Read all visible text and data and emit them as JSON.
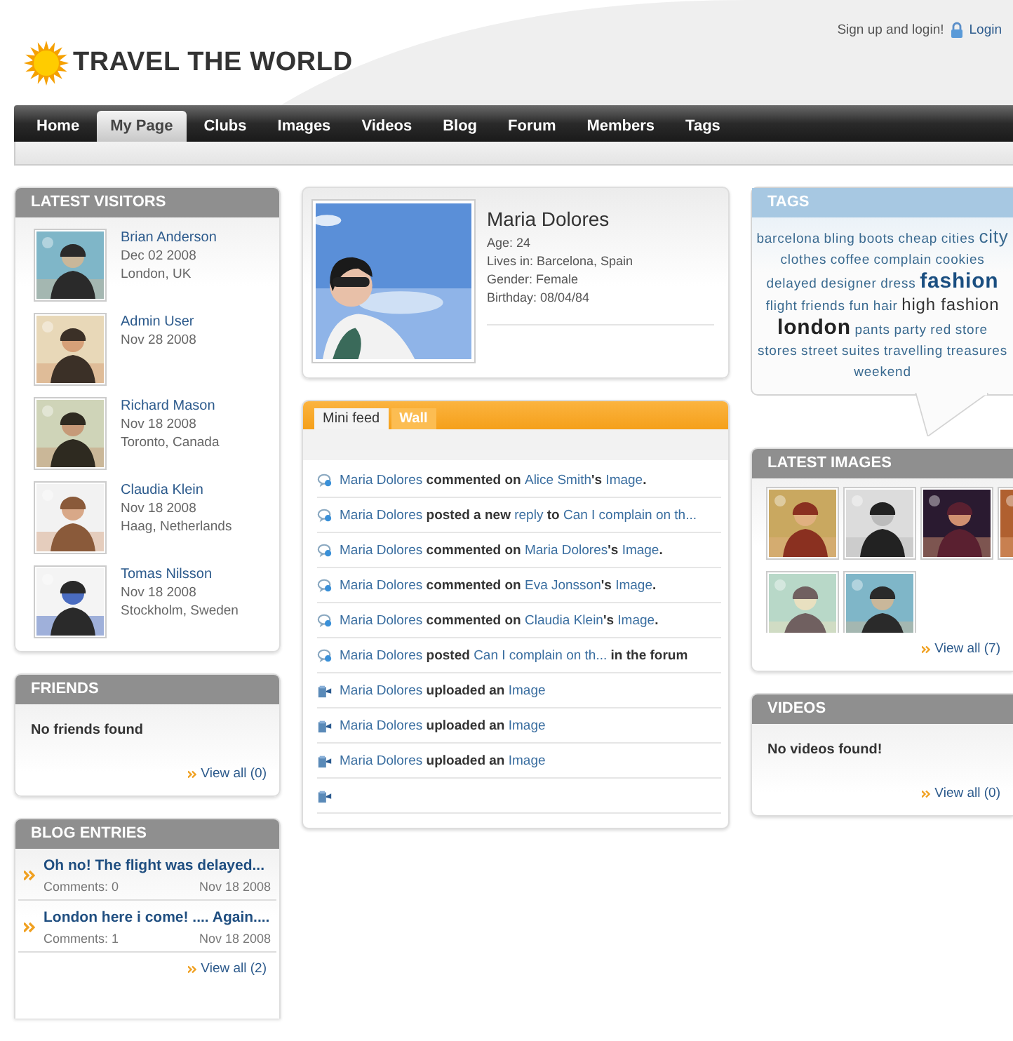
{
  "logo": {
    "title": "TRAVEL THE WORLD"
  },
  "top_links": {
    "prompt": "Sign up and login!",
    "login": "Login"
  },
  "nav": [
    {
      "label": "Home",
      "selected": false
    },
    {
      "label": "My Page",
      "selected": true
    },
    {
      "label": "Clubs",
      "selected": false
    },
    {
      "label": "Images",
      "selected": false
    },
    {
      "label": "Videos",
      "selected": false
    },
    {
      "label": "Blog",
      "selected": false
    },
    {
      "label": "Forum",
      "selected": false
    },
    {
      "label": "Members",
      "selected": false
    },
    {
      "label": "Tags",
      "selected": false
    }
  ],
  "latest_visitors": {
    "title": "LATEST VISITORS",
    "items": [
      {
        "name": "Brian Anderson",
        "date": "Dec 02 2008",
        "location": "London, UK"
      },
      {
        "name": "Admin User",
        "date": "Nov 28 2008"
      },
      {
        "name": "Richard Mason",
        "date": "Nov 18 2008",
        "location": "Toronto, Canada"
      },
      {
        "name": "Claudia Klein",
        "date": "Nov 18 2008",
        "location": "Haag, Netherlands"
      },
      {
        "name": "Tomas Nilsson",
        "date": "Nov 18 2008",
        "location": "Stockholm, Sweden"
      }
    ]
  },
  "friends": {
    "title": "FRIENDS",
    "empty": "No friends found",
    "view_all": "View all (0)"
  },
  "blog_entries": {
    "title": "BLOG ENTRIES",
    "items": [
      {
        "title": "Oh no! The flight was delayed...",
        "comments": "Comments: 0",
        "date": "Nov 18 2008"
      },
      {
        "title": "London here i come! .... Again....",
        "comments": "Comments: 1",
        "date": "Nov 18 2008"
      }
    ],
    "view_all": "View all (2)"
  },
  "profile": {
    "name": "Maria Dolores",
    "details": [
      "Age: 24",
      "Lives in: Barcelona, Spain",
      "Gender: Female",
      "Birthday: 08/04/84"
    ]
  },
  "feed": {
    "tabs": [
      {
        "label": "Mini feed",
        "selected": true
      },
      {
        "label": "Wall",
        "selected": false
      }
    ],
    "items": [
      {
        "kind": "comment",
        "parts": [
          {
            "text": "Maria Dolores",
            "kind": "link"
          },
          {
            "text": " commented on ",
            "kind": "text"
          },
          {
            "text": "Alice Smith",
            "kind": "link"
          },
          {
            "text": "'s ",
            "kind": "text"
          },
          {
            "text": "Image",
            "kind": "link"
          },
          {
            "text": ".",
            "kind": "text"
          }
        ]
      },
      {
        "kind": "comment",
        "parts": [
          {
            "text": "Maria Dolores",
            "kind": "link"
          },
          {
            "text": " posted a new ",
            "kind": "text"
          },
          {
            "text": "reply",
            "kind": "link"
          },
          {
            "text": " to ",
            "kind": "text"
          },
          {
            "text": "Can I complain on th...",
            "kind": "link"
          }
        ]
      },
      {
        "kind": "comment",
        "parts": [
          {
            "text": "Maria Dolores",
            "kind": "link"
          },
          {
            "text": " commented on ",
            "kind": "text"
          },
          {
            "text": "Maria Dolores",
            "kind": "link"
          },
          {
            "text": "'s ",
            "kind": "text"
          },
          {
            "text": "Image",
            "kind": "link"
          },
          {
            "text": ".",
            "kind": "text"
          }
        ]
      },
      {
        "kind": "comment",
        "parts": [
          {
            "text": "Maria Dolores",
            "kind": "link"
          },
          {
            "text": " commented on ",
            "kind": "text"
          },
          {
            "text": "Eva Jonsson",
            "kind": "link"
          },
          {
            "text": "'s ",
            "kind": "text"
          },
          {
            "text": "Image",
            "kind": "link"
          },
          {
            "text": ".",
            "kind": "text"
          }
        ]
      },
      {
        "kind": "comment",
        "parts": [
          {
            "text": "Maria Dolores",
            "kind": "link"
          },
          {
            "text": " commented on ",
            "kind": "text"
          },
          {
            "text": "Claudia Klein",
            "kind": "link"
          },
          {
            "text": "'s ",
            "kind": "text"
          },
          {
            "text": "Image",
            "kind": "link"
          },
          {
            "text": ".",
            "kind": "text"
          }
        ]
      },
      {
        "kind": "comment",
        "parts": [
          {
            "text": "Maria Dolores",
            "kind": "link"
          },
          {
            "text": " posted ",
            "kind": "text"
          },
          {
            "text": "Can I complain on th...",
            "kind": "link"
          },
          {
            "text": " in the forum",
            "kind": "text"
          }
        ]
      },
      {
        "kind": "upload",
        "parts": [
          {
            "text": "Maria Dolores",
            "kind": "link"
          },
          {
            "text": " uploaded an ",
            "kind": "text"
          },
          {
            "text": "Image",
            "kind": "link"
          }
        ]
      },
      {
        "kind": "upload",
        "parts": [
          {
            "text": "Maria Dolores",
            "kind": "link"
          },
          {
            "text": " uploaded an ",
            "kind": "text"
          },
          {
            "text": "Image",
            "kind": "link"
          }
        ]
      },
      {
        "kind": "upload",
        "parts": [
          {
            "text": "Maria Dolores",
            "kind": "link"
          },
          {
            "text": " uploaded an ",
            "kind": "text"
          },
          {
            "text": "Image",
            "kind": "link"
          }
        ]
      },
      {
        "kind": "upload"
      }
    ]
  },
  "tags": {
    "title": "TAGS",
    "items": [
      {
        "text": "barcelona",
        "kind": "small"
      },
      {
        "text": "bling",
        "kind": "small"
      },
      {
        "text": "boots",
        "kind": "small"
      },
      {
        "text": "cheap",
        "kind": "small"
      },
      {
        "text": "cities",
        "kind": "small"
      },
      {
        "text": "city",
        "kind": "medium"
      },
      {
        "text": "clothes",
        "kind": "small"
      },
      {
        "text": "coffee",
        "kind": "small"
      },
      {
        "text": "complain",
        "kind": "small"
      },
      {
        "text": "cookies",
        "kind": "small"
      },
      {
        "text": "delayed",
        "kind": "small"
      },
      {
        "text": "designer",
        "kind": "small"
      },
      {
        "text": "dress",
        "kind": "small"
      },
      {
        "text": "fashion",
        "kind": "large-blue"
      },
      {
        "text": "flight",
        "kind": "small"
      },
      {
        "text": "friends",
        "kind": "small"
      },
      {
        "text": "fun",
        "kind": "small"
      },
      {
        "text": "hair",
        "kind": "small"
      },
      {
        "text": "high fashion",
        "kind": "medium-dark"
      },
      {
        "text": "london",
        "kind": "large-dark"
      },
      {
        "text": "pants",
        "kind": "small"
      },
      {
        "text": "party",
        "kind": "small"
      },
      {
        "text": "red",
        "kind": "small"
      },
      {
        "text": "store",
        "kind": "small"
      },
      {
        "text": "stores",
        "kind": "small"
      },
      {
        "text": "street",
        "kind": "small"
      },
      {
        "text": "suites",
        "kind": "small"
      },
      {
        "text": "travelling",
        "kind": "small"
      },
      {
        "text": "treasures",
        "kind": "small"
      },
      {
        "text": "weekend",
        "kind": "small"
      }
    ]
  },
  "latest_images": {
    "title": "LATEST IMAGES",
    "view_all": "View all (7)"
  },
  "videos": {
    "title": "VIDEOS",
    "empty": "No videos found!",
    "view_all": "View all (0)"
  }
}
